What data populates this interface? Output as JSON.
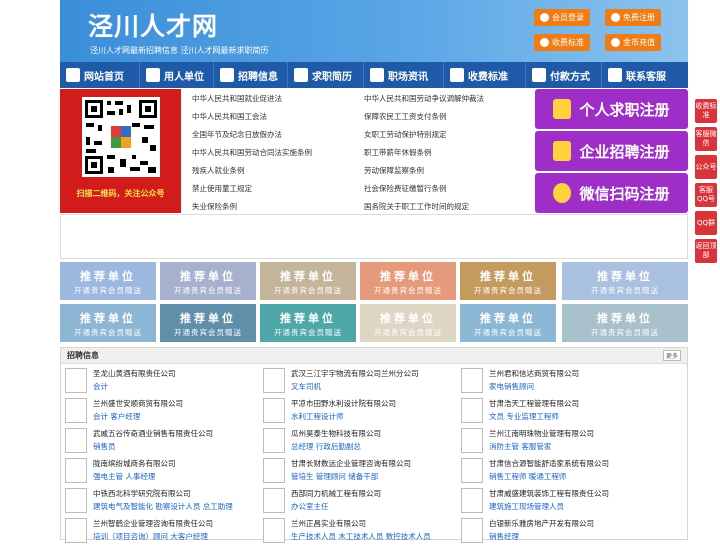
{
  "site": {
    "logo": "泾川人才网",
    "slogan": "泾川人才网最新招聘信息   泾川人才网最新求职简历"
  },
  "header_buttons": [
    {
      "label": "会员登录",
      "icon": "user-icon"
    },
    {
      "label": "免费注册",
      "icon": "register-icon"
    },
    {
      "label": "收费标准",
      "icon": "price-icon"
    },
    {
      "label": "金币充值",
      "icon": "coin-icon"
    }
  ],
  "nav": [
    {
      "label": "网站首页",
      "icon": "home-icon"
    },
    {
      "label": "用人单位",
      "icon": "building-icon"
    },
    {
      "label": "招聘信息",
      "icon": "recruit-icon"
    },
    {
      "label": "求职简历",
      "icon": "resume-icon"
    },
    {
      "label": "职场资讯",
      "icon": "news-icon"
    },
    {
      "label": "收费标准",
      "icon": "fee-icon"
    },
    {
      "label": "付款方式",
      "icon": "payment-icon"
    },
    {
      "label": "联系客服",
      "icon": "phone-icon"
    }
  ],
  "qr": {
    "caption": "扫描二维码，关注公众号"
  },
  "policies": [
    "中华人民共和国就业促进法",
    "中华人民共和国劳动争议调解仲裁法",
    "中华人民共和国工会法",
    "保障农民工工资支付条例",
    "全国年节及纪念日放假办法",
    "女职工劳动保护特别规定",
    "中华人民共和国劳动合同法实施条例",
    "职工带薪年休假条例",
    "残疾人就业条例",
    "劳动保障监察条例",
    "禁止使用童工规定",
    "社会保险费征缴暂行条例",
    "失业保险条例",
    "国务院关于职工工作时间的规定"
  ],
  "register_buttons": [
    {
      "label": "个人求职注册",
      "icon": "person-icon"
    },
    {
      "label": "企业招聘注册",
      "icon": "enterprise-icon"
    },
    {
      "label": "微信扫码注册",
      "icon": "wechat-icon"
    }
  ],
  "ads": {
    "title": "推荐单位",
    "subtitle": "开通贵宾会员赠送",
    "colors": [
      "#9db8de",
      "#a7b1ce",
      "#c4b49a",
      "#e59a7c",
      "#c49a5e",
      "#a9c0df",
      "#8cb6d3",
      "#5f8fa9",
      "#4fa7a8",
      "#ddd6c2",
      "#8cb8d6",
      "#a9c1cc"
    ]
  },
  "jobs": {
    "title": "招聘信息",
    "more": "更多",
    "columns": [
      [
        {
          "company": "圣龙山黄酒有限责任公司",
          "jobs": "会计"
        },
        {
          "company": "兰州盛世安顺商贸有限公司",
          "jobs": "会计 客户经理"
        },
        {
          "company": "武威五谷传奇酒业销售有限责任公司",
          "jobs": "销售员"
        },
        {
          "company": "陇南缤纷城商务有限公司",
          "jobs": "强电主管 人事经理"
        },
        {
          "company": "中铁西北科学研究院有限公司",
          "jobs": "建筑电气及智能化 勘察设计人员 总工助理"
        },
        {
          "company": "兰州智鹤企业管理咨询有限责任公司",
          "jobs": "培训（项目咨询）顾问 大客户经理"
        }
      ],
      [
        {
          "company": "武汉三江宇宇物流有限公司兰州分公司",
          "jobs": "叉车司机"
        },
        {
          "company": "平凉市田野水利设计院有限公司",
          "jobs": "水利工程设计师"
        },
        {
          "company": "瓜州昊泰生物科技有限公司",
          "jobs": "总经理 行政后勤副总"
        },
        {
          "company": "甘肃长财数远企业管理咨询有限公司",
          "jobs": "管培生 管理顾问 储备干部"
        },
        {
          "company": "西部同力机械工程有限公司",
          "jobs": "办公室主任"
        },
        {
          "company": "兰州正昌实业有限公司",
          "jobs": "生产技术人员 木工技术人员 数控技术人员"
        }
      ],
      [
        {
          "company": "兰州君和信达商贸有限公司",
          "jobs": "家电销售顾问"
        },
        {
          "company": "甘肃浩天工程管理有限公司",
          "jobs": "文员 专业监理工程师"
        },
        {
          "company": "兰州江南明珠物业管理有限公司",
          "jobs": "消防主管 客服管家"
        },
        {
          "company": "甘肃信合源智能舒适家系统有限公司",
          "jobs": "销售工程师 暖通工程师"
        },
        {
          "company": "甘肃威盛建筑装饰工程有限责任公司",
          "jobs": "建筑施工现场管理人员"
        },
        {
          "company": "白银新乐雅房地产开发有限公司",
          "jobs": "销售经理"
        }
      ]
    ]
  },
  "side_float": [
    "收费标准",
    "客服微信",
    "公众号",
    "客服QQ号",
    "QQ群",
    "返回顶部"
  ]
}
